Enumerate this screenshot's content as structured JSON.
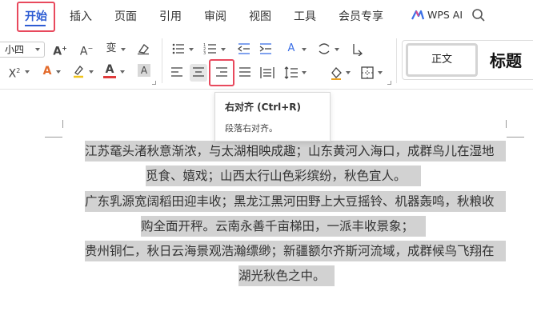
{
  "menu": {
    "tabs": [
      {
        "label": "开始",
        "active": true
      },
      {
        "label": "插入"
      },
      {
        "label": "页面"
      },
      {
        "label": "引用"
      },
      {
        "label": "审阅"
      },
      {
        "label": "视图"
      },
      {
        "label": "工具"
      },
      {
        "label": "会员专享"
      }
    ],
    "wps_ai_label": "WPS AI",
    "accent_color": "#2d5cd3",
    "highlight_color": "#e8495d"
  },
  "ribbon": {
    "font_size_value": "小四",
    "styles": {
      "normal_label": "正文",
      "heading_label": "标题"
    }
  },
  "tooltip": {
    "title": "右对齐 (Ctrl+R)",
    "description": "段落右对齐。"
  },
  "document": {
    "lines": [
      "江苏鼋头渚秋意渐浓，与太湖相映成趣；山东黄河入海口，成群鸟儿在湿地",
      "觅食、嬉戏；山西太行山色彩缤纷，秋色宜人。",
      "广东乳源宽阔稻田迎丰收；黑龙江黑河田野上大豆摇铃、机器轰鸣，秋粮收",
      "购全面开秤。云南永善千亩梯田，一派丰收景象；",
      "贵州铜仁，秋日云海景观浩瀚缥缈；新疆额尔齐斯河流域，成群候鸟飞翔在",
      "湖光秋色之中。"
    ],
    "selection_color": "#d2d2d2"
  }
}
